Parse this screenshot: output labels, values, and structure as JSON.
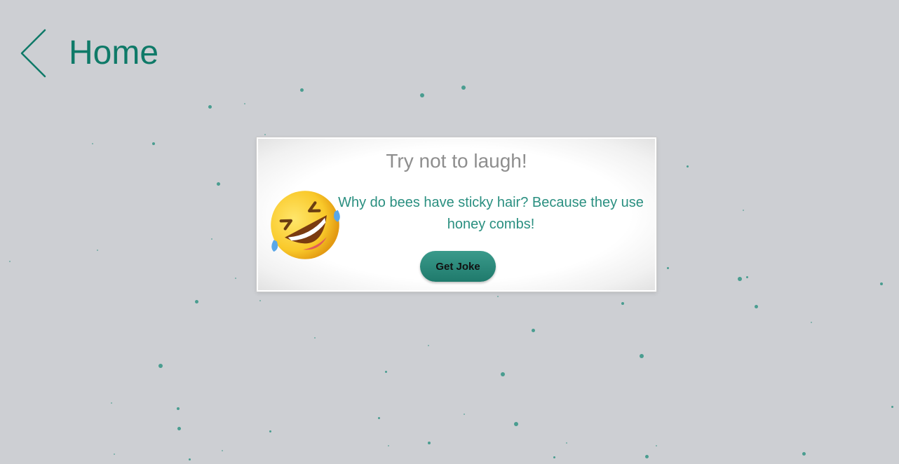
{
  "nav": {
    "back_icon": "chevron-left-icon",
    "home_label": "Home"
  },
  "card": {
    "title": "Try not to laugh!",
    "emoji_icon": "rolling-on-floor-laughing-emoji",
    "joke": "Why do bees have sticky hair? Because they use honey combs!",
    "button_label": "Get Joke"
  },
  "colors": {
    "accent": "#0f7a68",
    "joke_text": "#2a8f80",
    "title_text": "#8e8e8e",
    "background": "#cdcfd3",
    "particle": "#4a9d90",
    "button": "#2a8a7b"
  }
}
